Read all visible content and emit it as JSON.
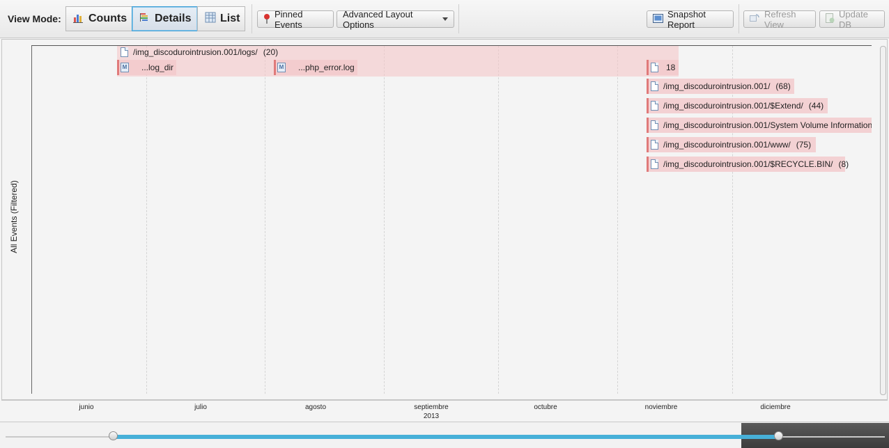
{
  "toolbar": {
    "view_mode_label": "View Mode:",
    "modes": [
      {
        "label": "Counts",
        "icon": "bar-chart-icon",
        "selected": false
      },
      {
        "label": "Details",
        "icon": "details-icon",
        "selected": true
      },
      {
        "label": "List",
        "icon": "table-icon",
        "selected": false
      }
    ],
    "pinned_events": "Pinned Events",
    "advanced_layout": "Advanced Layout Options",
    "snapshot_report": "Snapshot Report",
    "refresh_view": "Refresh View",
    "update_db": "Update DB",
    "accent_color": "#3c9fd6"
  },
  "timeline": {
    "vertical_axis_label": "All Events (Filtered)",
    "events": [
      {
        "label": "/img_discodurointrusion.001/logs/",
        "count": "(20)"
      },
      {
        "label": "...log_dir",
        "count": ""
      },
      {
        "label": "...php_error.log",
        "count": ""
      },
      {
        "label": "18",
        "count": ""
      },
      {
        "label": "/img_discodurointrusion.001/",
        "count": "(68)"
      },
      {
        "label": "/img_discodurointrusion.001/$Extend/",
        "count": "(44)"
      },
      {
        "label": "/img_discodurointrusion.001/System Volume Information",
        "count": ""
      },
      {
        "label": "/img_discodurointrusion.001/www/",
        "count": "(75)"
      },
      {
        "label": "/img_discodurointrusion.001/$RECYCLE.BIN/",
        "count": "(8)"
      }
    ],
    "event_color": "#f3c6c8",
    "event_bar_color": "#e07a7a"
  },
  "axis": {
    "months": [
      "junio",
      "julio",
      "agosto",
      "septiembre",
      "octubre",
      "noviembre",
      "diciembre"
    ],
    "year": "2013"
  },
  "range_slider": {
    "fill_color": "#47b0d8"
  }
}
